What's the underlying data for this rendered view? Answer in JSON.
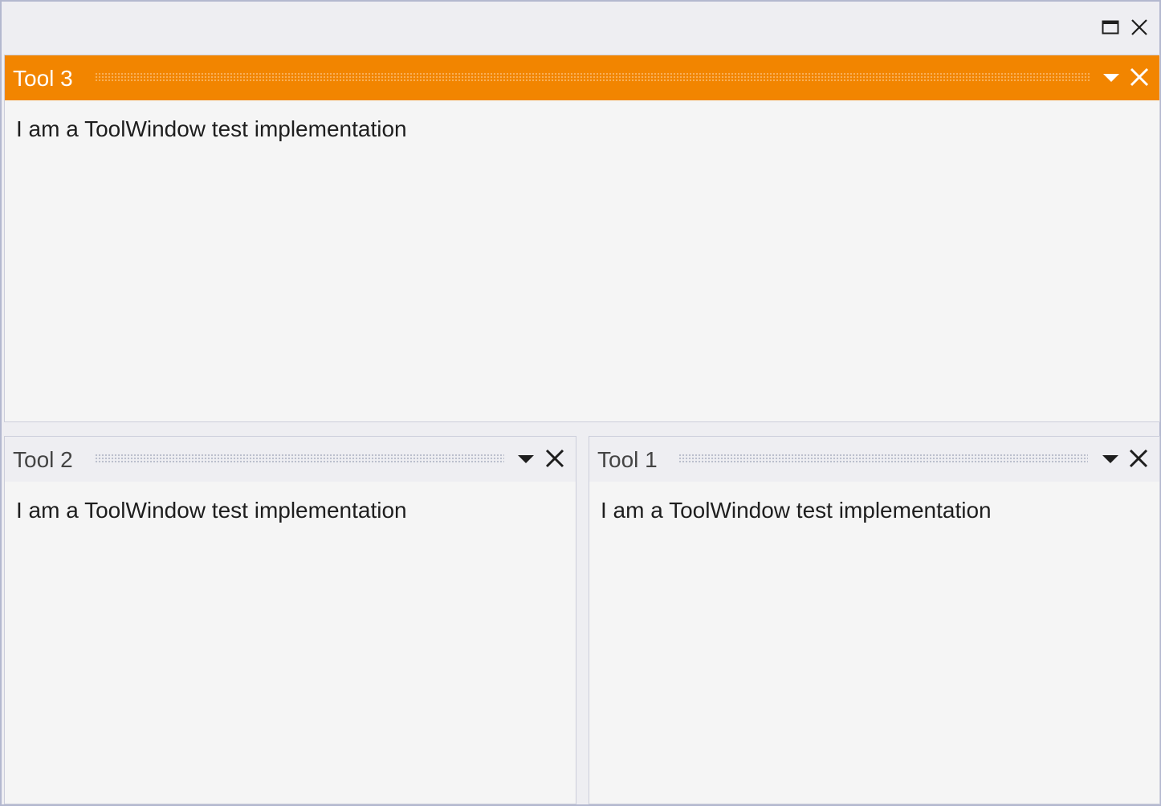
{
  "window": {
    "maximize_icon": "maximize-icon",
    "close_icon": "close-icon"
  },
  "panes": {
    "top": {
      "title": "Tool 3",
      "active": true,
      "content": "I am a ToolWindow test implementation"
    },
    "bottom_left": {
      "title": "Tool 2",
      "active": false,
      "content": "I am a ToolWindow test implementation"
    },
    "bottom_right": {
      "title": "Tool 1",
      "active": false,
      "content": "I am a ToolWindow test implementation"
    }
  },
  "colors": {
    "active_header": "#f28500",
    "inactive_header": "#eeeef2",
    "body_background": "#f5f5f5",
    "window_border": "#b3b8cf"
  }
}
